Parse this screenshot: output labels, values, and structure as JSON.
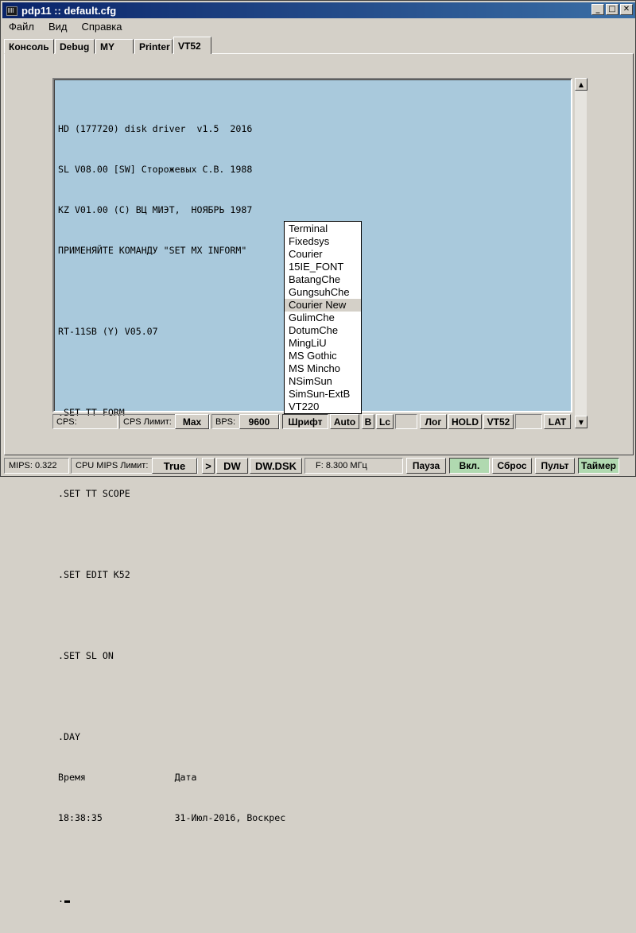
{
  "window": {
    "title": "pdp11 :: default.cfg"
  },
  "menu": [
    "Файл",
    "Вид",
    "Справка"
  ],
  "tabs": [
    "Консоль",
    "Debug",
    "MY",
    "Printer",
    "VT52"
  ],
  "terminal": {
    "lines": [
      "HD (177720) disk driver  v1.5  2016",
      "SL V08.00 [SW] Сторожевых С.В. 1988",
      "KZ V01.00 (C) ВЦ МИЭТ,  НОЯБРЬ 1987",
      "ПРИМЕНЯЙТЕ КОМАНДУ \"SET MX INFORM\"",
      "",
      "RT-11SB (Y) V05.07",
      "",
      ".SET TT FORM",
      "",
      ".SET TT SCOPE",
      "",
      ".SET EDIT K52",
      "",
      ".SET SL ON",
      "",
      ".DAY",
      "Время                Дата",
      "18:38:35             31-Июл-2016, Воскрес",
      "",
      "."
    ]
  },
  "font_menu": {
    "items": [
      "Terminal",
      "Fixedsys",
      "Courier",
      "15IE_FONT",
      "BatangChe",
      "GungsuhChe",
      "Courier New",
      "GulimChe",
      "DotumChe",
      "MingLiU",
      "MS Gothic",
      "MS Mincho",
      "NSimSun",
      "SimSun-ExtB",
      "VT220"
    ],
    "highlighted": "Courier New"
  },
  "term_status": {
    "cps_label": "CPS:",
    "cps_limit_label": "CPS Лимит:",
    "cps_limit_value": "Max",
    "bps_label": "BPS:",
    "bps_value": "9600",
    "font_button": "Шрифт",
    "auto_button": "Auto",
    "b_button": "B",
    "lc_button": "Lc",
    "log_button": "Лог",
    "hold_button": "HOLD",
    "vt52_button": "VT52",
    "lat_button": "LAT"
  },
  "bottom_bar": {
    "mips": "MIPS:  0.322",
    "cpu_limit_label": "CPU MIPS Лимит:",
    "cpu_limit_value": "True",
    "arrow": ">",
    "dw": "DW",
    "dw_dsk": "DW.DSK",
    "freq": "F: 8.300 МГц",
    "pause": "Пауза",
    "on": "Вкл.",
    "reset": "Сброс",
    "panel": "Пульт",
    "timer": "Таймер"
  },
  "colors": {
    "terminal_bg": "#a9c9dc",
    "active_green": "#b0d9b0",
    "titlebar": "#0a246a"
  }
}
